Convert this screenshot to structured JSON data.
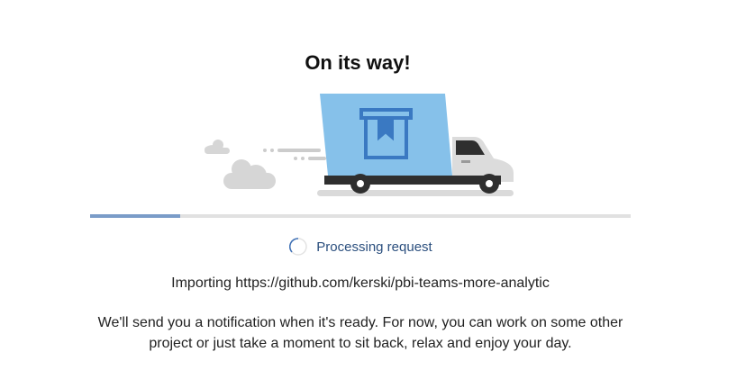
{
  "dialog": {
    "title": "On its way!",
    "progress_fraction": 0.167,
    "status_text": "Processing request",
    "import_line": "Importing https://github.com/kerski/pbi-teams-more-analytic",
    "message": "We'll send you a notification when it's ready. For now, you can work on some other project or just take a moment to sit back, relax and enjoy your day."
  },
  "illustration": {
    "icon": "delivery-truck-icon",
    "cargo_icon": "package-box-icon",
    "colors": {
      "cargo": "#86c1ea",
      "cargo_outline": "#3a79c2",
      "cab": "#d9d9d9",
      "wheels": "#333333",
      "clouds": "#d5d5d5"
    }
  },
  "colors": {
    "progress_fill": "#7a9cc8",
    "progress_track": "#e1e1e1",
    "status_text": "#2b4f7e"
  }
}
